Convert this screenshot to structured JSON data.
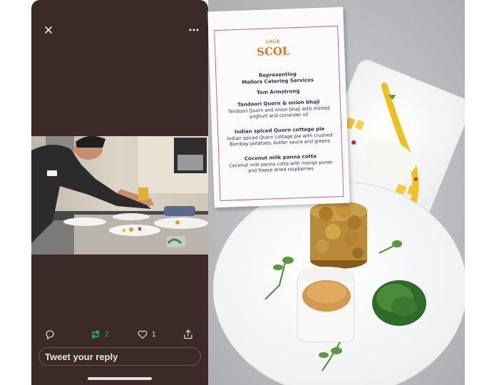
{
  "tweet": {
    "close_icon": "close-icon",
    "more_icon": "more-horizontal-icon",
    "reply_icon": "reply-icon",
    "retweet_icon": "retweet-icon",
    "like_icon": "heart-icon",
    "share_icon": "share-icon",
    "retweet_count": "2",
    "like_count": "1",
    "reply_placeholder": "Tweet your reply",
    "retweet_active_color": "#16c47f",
    "background_color": "#3b2a27"
  },
  "menu_card": {
    "logo_top": "LACA",
    "logo_main": "SCOL",
    "representing": "Representing",
    "company": "Mellors Catering Services",
    "chef": "Tom Armstrong",
    "courses": [
      {
        "title": "Tandoori Quorn & onion bhaji",
        "line1": "Tandoori Quorn and onion bhaji with minted",
        "line2": "yoghurt and coriander oil"
      },
      {
        "title": "Indian spiced Quorn cottage pie",
        "line1": "Indian spiced Quorn cottage pie with crushed",
        "line2": "Bombay potatoes, butter sauce and greens"
      },
      {
        "title": "Coconut milk panna cotta",
        "line1": "Coconut milk panna cotta with mango puree",
        "line2": "and freeze dried raspberries"
      }
    ],
    "accent_color": "#c66b78"
  }
}
